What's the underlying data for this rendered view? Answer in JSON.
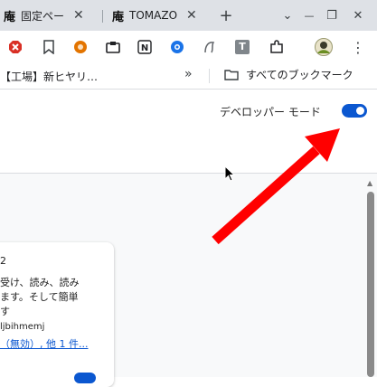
{
  "tabs": [
    {
      "icon": "庵",
      "title": "固定ペー"
    },
    {
      "icon": "庵",
      "title": "TOMAZO"
    }
  ],
  "tab_close_glyph": "✕",
  "new_tab_glyph": "+",
  "window": {
    "minimize": "⌄",
    "restore": "—",
    "maximize": "❐",
    "close": "✕"
  },
  "bookmarks": {
    "first_item": "【工場】新ヒヤリ…",
    "overflow": "»",
    "all_bookmarks": "すべてのブックマーク"
  },
  "toolbar_icon_names": [
    "adblock-icon",
    "bookmark-icon",
    "wordpress-icon",
    "clipper-icon",
    "notion-icon",
    "share-icon",
    "shield-script-icon",
    "text-icon",
    "extensions-icon",
    "profile-avatar-icon",
    "menu-icon"
  ],
  "toolbar_text_icon": "T",
  "toolbar_notion_letter": "N",
  "menu_glyph": "⋮",
  "page": {
    "developer_mode_label": "デベロッパー モード",
    "developer_mode_on": true
  },
  "extension_card": {
    "line1": "2",
    "line2": "受け、読み、読み",
    "line3": "ます。そして簡単",
    "line4": "す",
    "id_text": "ljbihmemj",
    "link_text": "（無効）, 他 1 件..."
  },
  "colors": {
    "accent": "#0b57d0",
    "annotation_arrow": "#ff0000"
  }
}
